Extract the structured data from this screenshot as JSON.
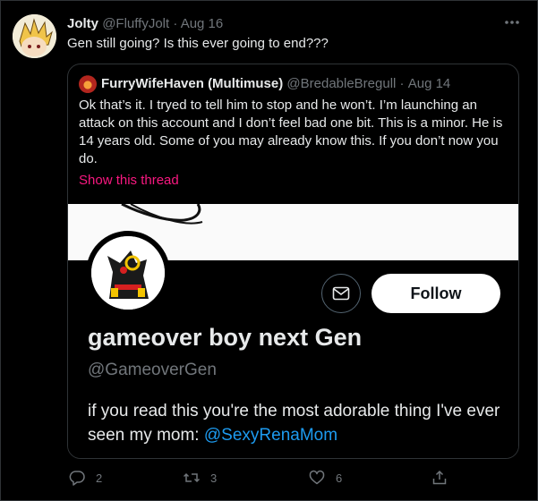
{
  "tweet": {
    "author_name": "Jolty",
    "author_handle": "@FluffyJolt",
    "separator": "·",
    "date": "Aug 16",
    "text": "Gen still going? Is this ever going to end???"
  },
  "quote": {
    "author_name": "FurryWifeHaven (Multimuse)",
    "author_handle": "@BredableBregull",
    "separator": "·",
    "date": "Aug 14",
    "text": "Ok that’s it. I tryed to tell him to stop and he won’t. I’m launching an attack on this account and I don’t feel bad one bit. This is a minor. He is 14 years old. Some of you may already know this. If you don’t now you do.",
    "show_thread": "Show this thread",
    "media": {
      "profile_name": "gameover boy next Gen",
      "profile_handle": "@GameoverGen",
      "bio_text": "if you read this you're the most adorable thing I've ever seen my mom: ",
      "bio_mention": "@SexyRenaMom",
      "follow_label": "Follow"
    }
  },
  "actions": {
    "reply_count": "2",
    "retweet_count": "3",
    "like_count": "6"
  },
  "colors": {
    "background": "#000000",
    "accent_pink": "#f91880",
    "link_blue": "#1d9bf0",
    "muted": "#71767b"
  }
}
